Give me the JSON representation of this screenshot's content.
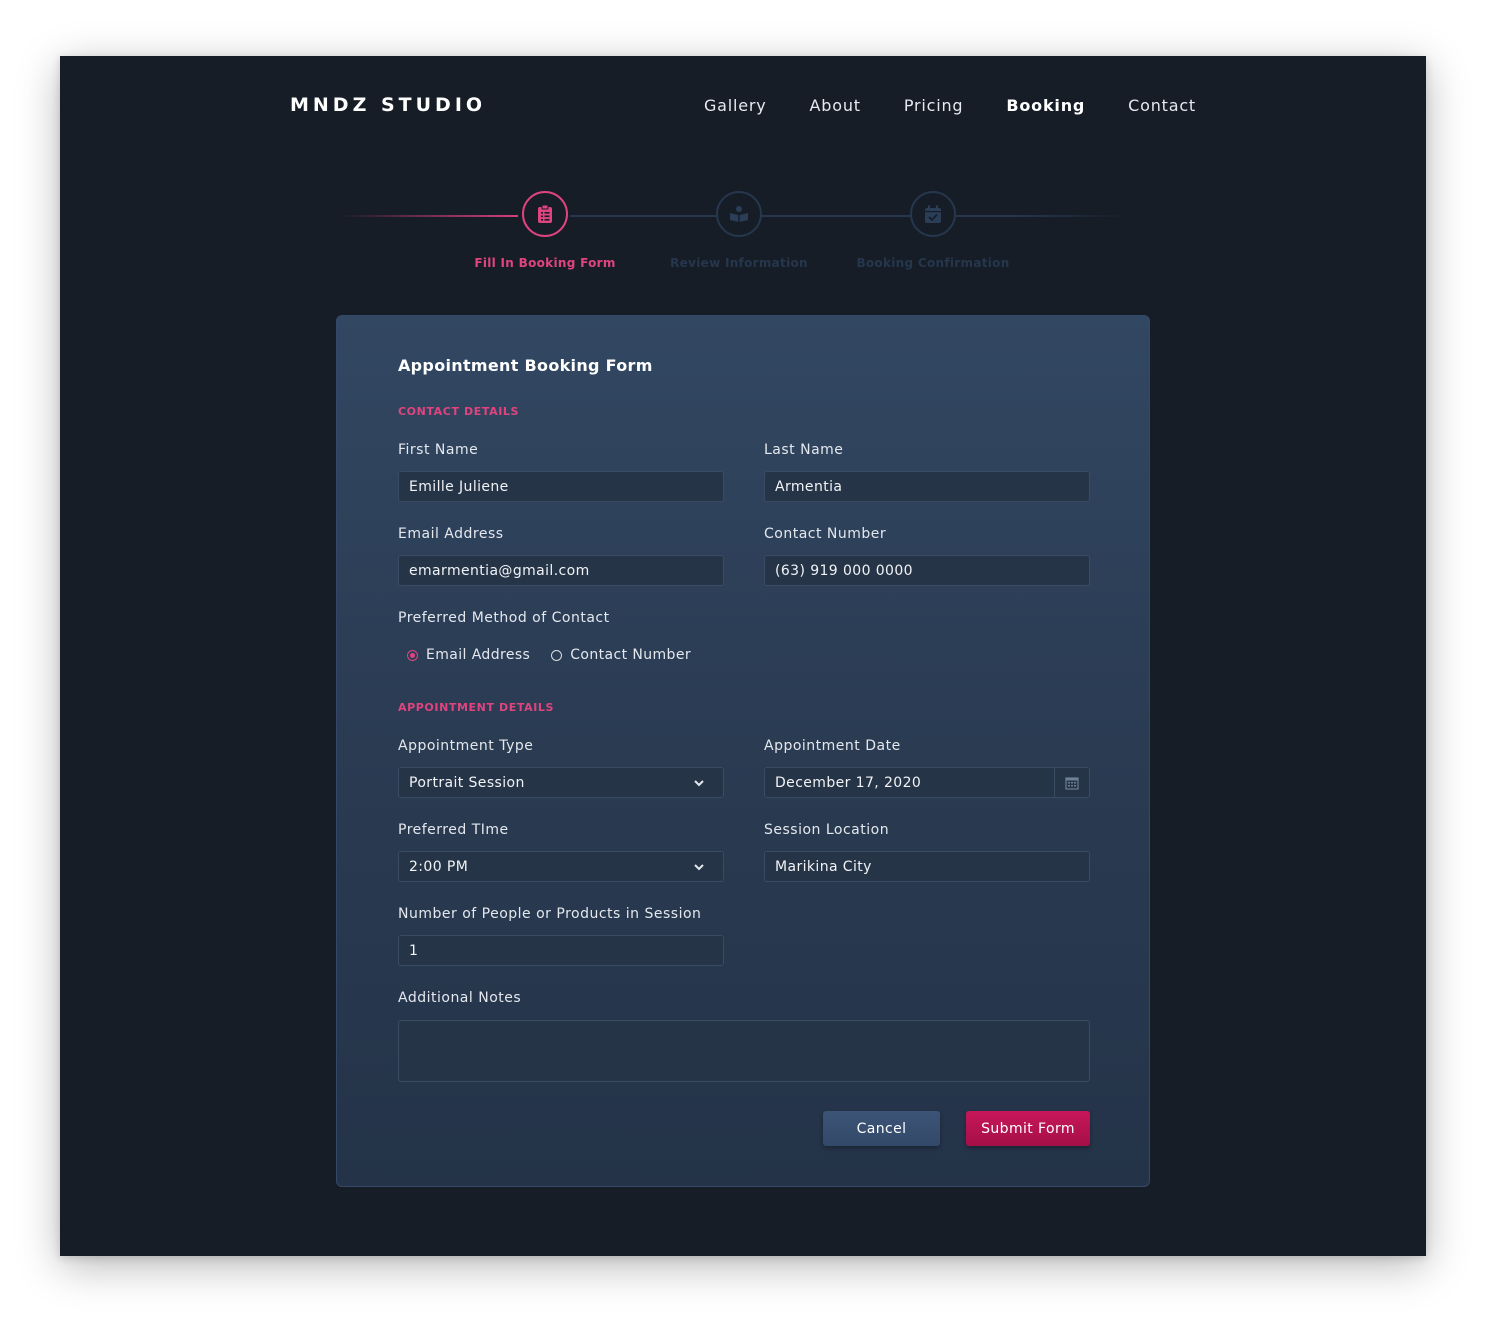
{
  "header": {
    "logo": "MNDZ STUDIO",
    "nav": [
      "Gallery",
      "About",
      "Pricing",
      "Booking",
      "Contact"
    ],
    "active_nav": "Booking"
  },
  "steps": [
    {
      "label": "Fill In Booking Form",
      "icon": "clipboard-icon",
      "state": "active"
    },
    {
      "label": "Review Information",
      "icon": "book-reader-icon",
      "state": "inactive"
    },
    {
      "label": "Booking Confirmation",
      "icon": "calendar-check-icon",
      "state": "inactive"
    }
  ],
  "form": {
    "title": "Appointment Booking Form",
    "contact_section": "CONTACT DETAILS",
    "first_name": {
      "label": "First Name",
      "value": "Emille Juliene"
    },
    "last_name": {
      "label": "Last Name",
      "value": "Armentia"
    },
    "email": {
      "label": "Email Address",
      "value": "emarmentia@gmail.com"
    },
    "phone": {
      "label": "Contact Number",
      "value": "(63) 919 000 0000"
    },
    "preferred_contact": {
      "label": "Preferred Method of Contact",
      "options": [
        "Email Address",
        "Contact Number"
      ],
      "selected": "Email Address"
    },
    "appointment_section": "APPOINTMENT DETAILS",
    "appointment_type": {
      "label": "Appointment Type",
      "value": "Portrait Session"
    },
    "appointment_date": {
      "label": "Appointment Date",
      "value": "December 17, 2020"
    },
    "preferred_time": {
      "label": "Preferred TIme",
      "value": "2:00 PM"
    },
    "session_location": {
      "label": "Session Location",
      "value": "Marikina City"
    },
    "people_count": {
      "label": "Number of People or Products in Session",
      "value": "1"
    },
    "notes": {
      "label": "Additional Notes",
      "value": ""
    },
    "cancel_label": "Cancel",
    "submit_label": "Submit Form"
  },
  "colors": {
    "background": "#161d27",
    "accent": "#e0447f",
    "submit": "#b3124f",
    "card": "#2d3f57"
  }
}
